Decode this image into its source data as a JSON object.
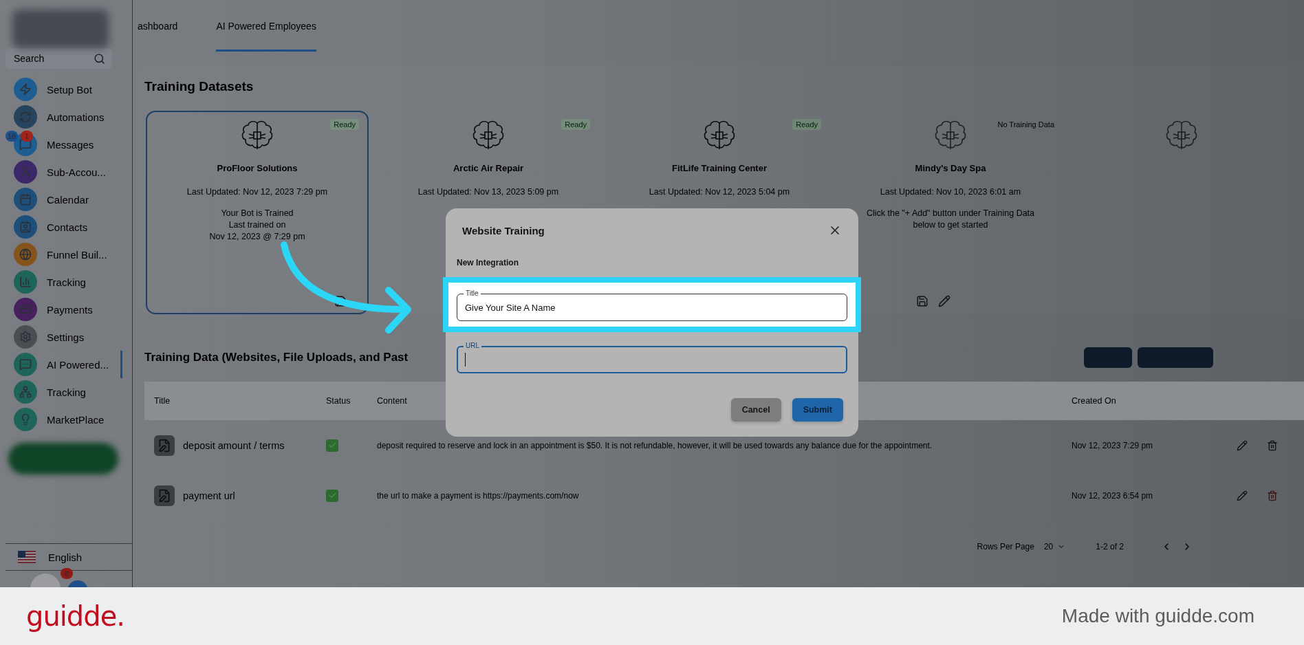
{
  "sidebar": {
    "search": {
      "placeholder": "Search"
    },
    "items": [
      {
        "label": "Setup Bot",
        "color": "#1d5d92",
        "selected": false
      },
      {
        "label": "Automations",
        "color": "#26445e",
        "selected": false
      },
      {
        "label": "Messages",
        "color": "#1d5d92",
        "selected": false,
        "badges": [
          {
            "count": "16",
            "color": "#1d4f8c"
          },
          {
            "count": "1",
            "color": "#a3231b"
          }
        ]
      },
      {
        "label": "Sub-Accou...",
        "color": "#3c2868",
        "selected": false
      },
      {
        "label": "Calendar",
        "color": "#1d4f7a",
        "selected": false
      },
      {
        "label": "Contacts",
        "color": "#1d4f7a",
        "selected": false
      },
      {
        "label": "Funnel Buil...",
        "color": "#85541a",
        "selected": false
      },
      {
        "label": "Tracking",
        "color": "#1e6459",
        "selected": false
      },
      {
        "label": "Payments",
        "color": "#47205e",
        "selected": false
      },
      {
        "label": "Settings",
        "color": "#4a4d52",
        "selected": false
      },
      {
        "label": "AI Powered...",
        "color": "#1e6459",
        "selected": true
      },
      {
        "label": "Tracking",
        "color": "#1e6459",
        "selected": false
      },
      {
        "label": "MarketPlace",
        "color": "#1e6459",
        "selected": false
      }
    ],
    "language": "English",
    "notification_count": "8"
  },
  "tabs": [
    {
      "label": "ashboard",
      "selected": false
    },
    {
      "label": "AI Powered Employees",
      "selected": true
    }
  ],
  "datasets": {
    "title": "Training Datasets",
    "cards": [
      {
        "title": "ProFloor Solutions",
        "status": "Ready",
        "kind": "trained",
        "selected": true,
        "updated": "Last Updated: Nov 12, 2023 7:29 pm",
        "lines": [
          "Your Bot is Trained",
          "Last trained on",
          "Nov 12, 2023 @ 7:29 pm"
        ],
        "actions": [
          {
            "kind": "save"
          }
        ]
      },
      {
        "title": "Arctic Air Repair",
        "status": "Ready",
        "kind": "trained",
        "selected": false,
        "updated": "Last Updated: Nov 13, 2023 5:09 pm"
      },
      {
        "title": "FitLife Training Center",
        "status": "Ready",
        "kind": "trained",
        "selected": false,
        "updated": "Last Updated: Nov 12, 2023 5:04 pm"
      },
      {
        "title": "Mindy's Day Spa",
        "status": "No Training Data",
        "kind": "untrained",
        "selected": false,
        "updated": "Last Updated: Nov 10, 2023 6:01 am",
        "lines": [
          "Click the \"+ Add\" button under Training Data below to get started"
        ],
        "actions": [
          {
            "kind": "save"
          },
          {
            "kind": "edit"
          }
        ]
      },
      {
        "kind": "untrained",
        "selected": false
      }
    ]
  },
  "training_data": {
    "title": "Training Data (Websites, File Uploads, and Past",
    "table": {
      "columns": [
        "Title",
        "Status",
        "Content",
        "Created On"
      ],
      "rows": [
        {
          "title": "deposit amount / terms",
          "checked": true,
          "content": "deposit required to reserve and lock in an appointment is $50. It is not refundable, however, it will be used towards any balance due for the appointment.",
          "created": "Nov 12, 2023 7:29 pm"
        },
        {
          "title": "payment url",
          "checked": true,
          "content": "the url to make a payment is https://payments.com/now",
          "created": "Nov 12, 2023 6:54 pm"
        }
      ]
    },
    "pagination": {
      "label": "Rows Per Page",
      "rows_per_page": "20",
      "range": "1-2 of 2"
    }
  },
  "dialog": {
    "title": "Website Training",
    "section": "New Integration",
    "fields": [
      {
        "label": "Title",
        "value": "Give Your Site A Name",
        "highlighted": true,
        "focused": false
      },
      {
        "label": "URL",
        "highlighted": false,
        "focused": true
      }
    ],
    "buttons": [
      {
        "label": "Cancel",
        "kind": "secondary"
      },
      {
        "label": "Submit",
        "kind": "primary"
      }
    ]
  },
  "footer": {
    "logo": "guidde.",
    "text": "Made with guidde.com"
  }
}
